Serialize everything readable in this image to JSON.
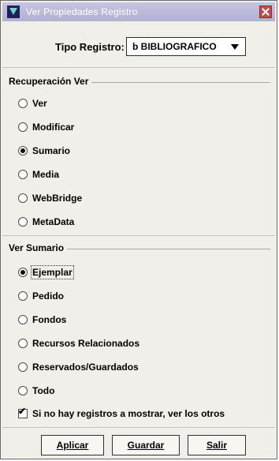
{
  "window": {
    "title": "Ver Propiedades Registro",
    "app_icon": "triangle-app-icon",
    "close_icon": "close-icon"
  },
  "tipo": {
    "label": "Tipo Registro:",
    "value": "b BIBLIOGRAFICO"
  },
  "recuperacion": {
    "title": "Recuperación Ver",
    "options": [
      {
        "label": "Ver",
        "checked": false
      },
      {
        "label": "Modificar",
        "checked": false
      },
      {
        "label": "Sumario",
        "checked": true
      },
      {
        "label": "Media",
        "checked": false
      },
      {
        "label": "WebBridge",
        "checked": false
      },
      {
        "label": "MetaData",
        "checked": false
      }
    ]
  },
  "sumario": {
    "title": "Ver Sumario",
    "options": [
      {
        "label": "Ejemplar",
        "checked": true
      },
      {
        "label": "Pedido",
        "checked": false
      },
      {
        "label": "Fondos",
        "checked": false
      },
      {
        "label": "Recursos Relacionados",
        "checked": false
      },
      {
        "label": "Reservados/Guardados",
        "checked": false
      },
      {
        "label": "Todo",
        "checked": false
      }
    ],
    "checkbox_label": "Si no hay registros a mostrar, ver los otros",
    "checkbox_checked": true
  },
  "buttons": {
    "apply": "Aplicar",
    "save": "Guardar",
    "exit": "Salir"
  }
}
